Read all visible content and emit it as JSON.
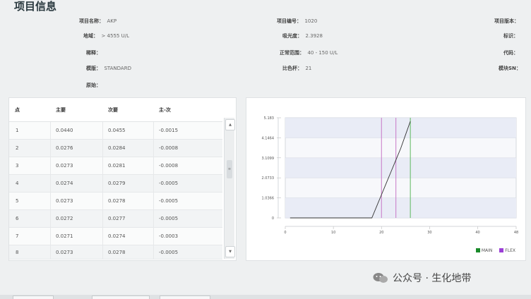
{
  "header": {
    "title": "项目信息"
  },
  "info": {
    "fields": [
      {
        "label": "项目名称：",
        "value": "AKP"
      },
      {
        "label": "地域：",
        "value": "> 4555 U/L"
      },
      {
        "label": "稀释：",
        "value": ""
      },
      {
        "label": "模版：",
        "value": "STANDARD"
      },
      {
        "label": "原始：",
        "value": ""
      },
      {
        "label": "项目编号：",
        "value": "1020"
      },
      {
        "label": "吸光度：",
        "value": "2.3928"
      },
      {
        "label": "正常范围：",
        "value": "40 - 150 U/L"
      },
      {
        "label": "比色杯：",
        "value": "21"
      },
      {
        "label": "项目版本：",
        "value": ""
      },
      {
        "label": "标识：",
        "value": ""
      },
      {
        "label": "代码：",
        "value": ""
      },
      {
        "label": "模块SN：",
        "value": ""
      }
    ]
  },
  "table": {
    "headers": [
      "点",
      "主要",
      "次要",
      "主-次"
    ],
    "rows": [
      [
        "1",
        "0.0440",
        "0.0455",
        "-0.0015"
      ],
      [
        "2",
        "0.0276",
        "0.0284",
        "-0.0008"
      ],
      [
        "3",
        "0.0273",
        "0.0281",
        "-0.0008"
      ],
      [
        "4",
        "0.0274",
        "0.0279",
        "-0.0005"
      ],
      [
        "5",
        "0.0273",
        "0.0278",
        "-0.0005"
      ],
      [
        "6",
        "0.0272",
        "0.0277",
        "-0.0005"
      ],
      [
        "7",
        "0.0271",
        "0.0274",
        "-0.0003"
      ],
      [
        "8",
        "0.0273",
        "0.0278",
        "-0.0005"
      ]
    ],
    "scroll_up": "▲",
    "scroll_down": "▼",
    "scroll_thumb": "≡"
  },
  "chart_data": {
    "type": "line",
    "x_ticks": [
      "0",
      "10",
      "20",
      "30",
      "40",
      "48"
    ],
    "x_tick_values": [
      0,
      10,
      20,
      30,
      40,
      48
    ],
    "y_ticks": [
      "0",
      "1.0366",
      "2.0733",
      "3.1099",
      "4.1464",
      "5.183"
    ],
    "y_tick_values": [
      0,
      1.0366,
      2.0733,
      3.1099,
      4.1464,
      5.183
    ],
    "xlim": [
      0,
      48
    ],
    "ylim": [
      0,
      5.183
    ],
    "series": [
      {
        "x": [
          1,
          18,
          19,
          20,
          21,
          22,
          23,
          24,
          25,
          26
        ],
        "y": [
          0,
          0,
          0.6,
          1.2,
          1.8,
          2.4,
          3.0,
          3.6,
          4.3,
          5.0
        ]
      }
    ],
    "markers": [
      {
        "x": 20,
        "color": "#c777c7"
      },
      {
        "x": 23,
        "color": "#c777c7"
      },
      {
        "x": 26,
        "color": "#5cb85c"
      }
    ],
    "bands": true,
    "legend": [
      {
        "name": "MAIN",
        "color": "#1a8a2a"
      },
      {
        "name": "FLEX",
        "color": "#9b3fd6"
      }
    ],
    "legend_position": "bottom-right"
  },
  "watermark": {
    "text": "公众号 · 生化地带"
  }
}
